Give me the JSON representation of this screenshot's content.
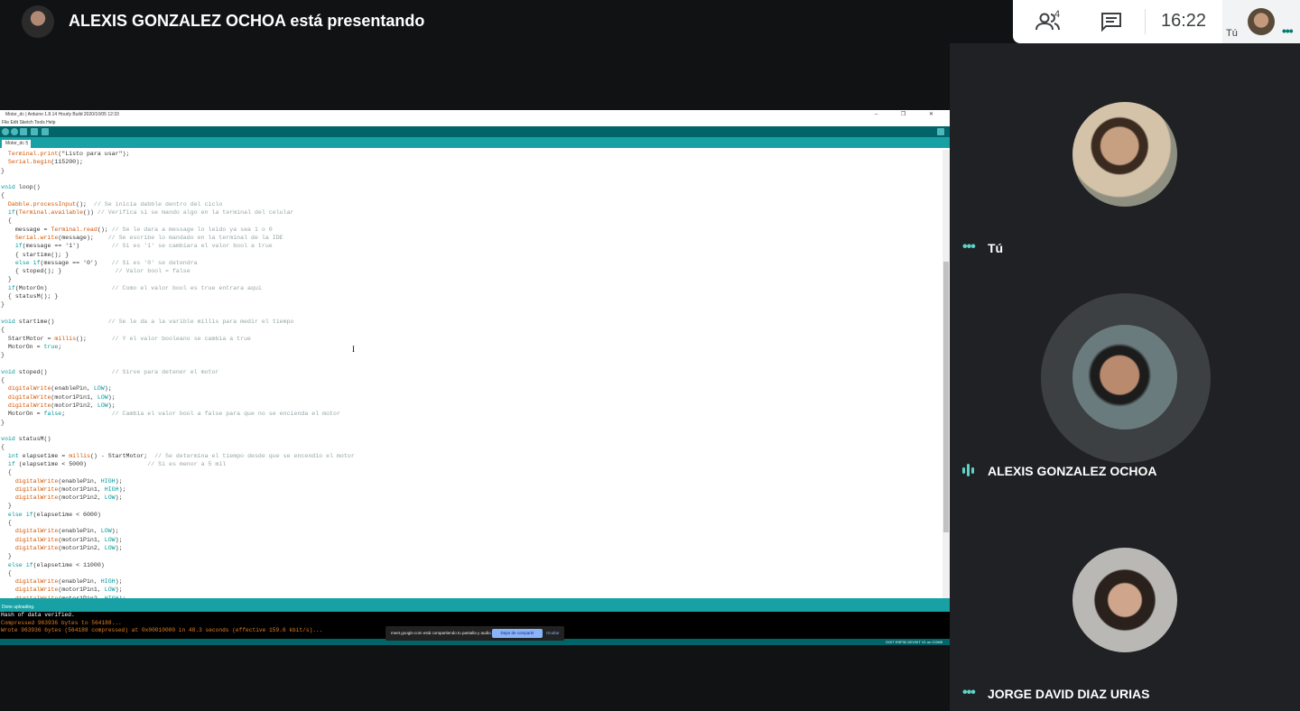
{
  "header": {
    "presenting_title": "ALEXIS GONZALEZ OCHOA está presentando"
  },
  "infobar": {
    "people_count": "4",
    "time": "16:22",
    "self_label": "Tú",
    "more_icon": "more-dots-icon"
  },
  "ide": {
    "window_title": "Motor_dc | Arduino 1.8.14 Hourly Build 2020/10/05 12:33",
    "window_buttons": "– ❐ ✕",
    "menu": "File Edit Sketch Tools Help",
    "tab_name": "Motor_dc §",
    "status_text": "Done uploading.",
    "console_lines": [
      "Hash of data verified.",
      "Compressed 963936 bytes to 564188...",
      "Wrote 963936 bytes (564188 compressed) at 0x00010000 in 48.3 seconds (effective 159.6 kbit/s)..."
    ],
    "board_info": "DOIT ESP32 DEVKIT V1 on COM5"
  },
  "share_notice": {
    "text": "meet.google.com está compartiendo tu pantalla y audio.",
    "stop_label": "Dejar de compartir",
    "hide_label": "Ocultar"
  },
  "participants": [
    {
      "name": "Tú",
      "status": "dots"
    },
    {
      "name": "ALEXIS GONZALEZ OCHOA",
      "status": "speaking"
    },
    {
      "name": "JORGE DAVID DIAZ URIAS",
      "status": "dots"
    }
  ]
}
